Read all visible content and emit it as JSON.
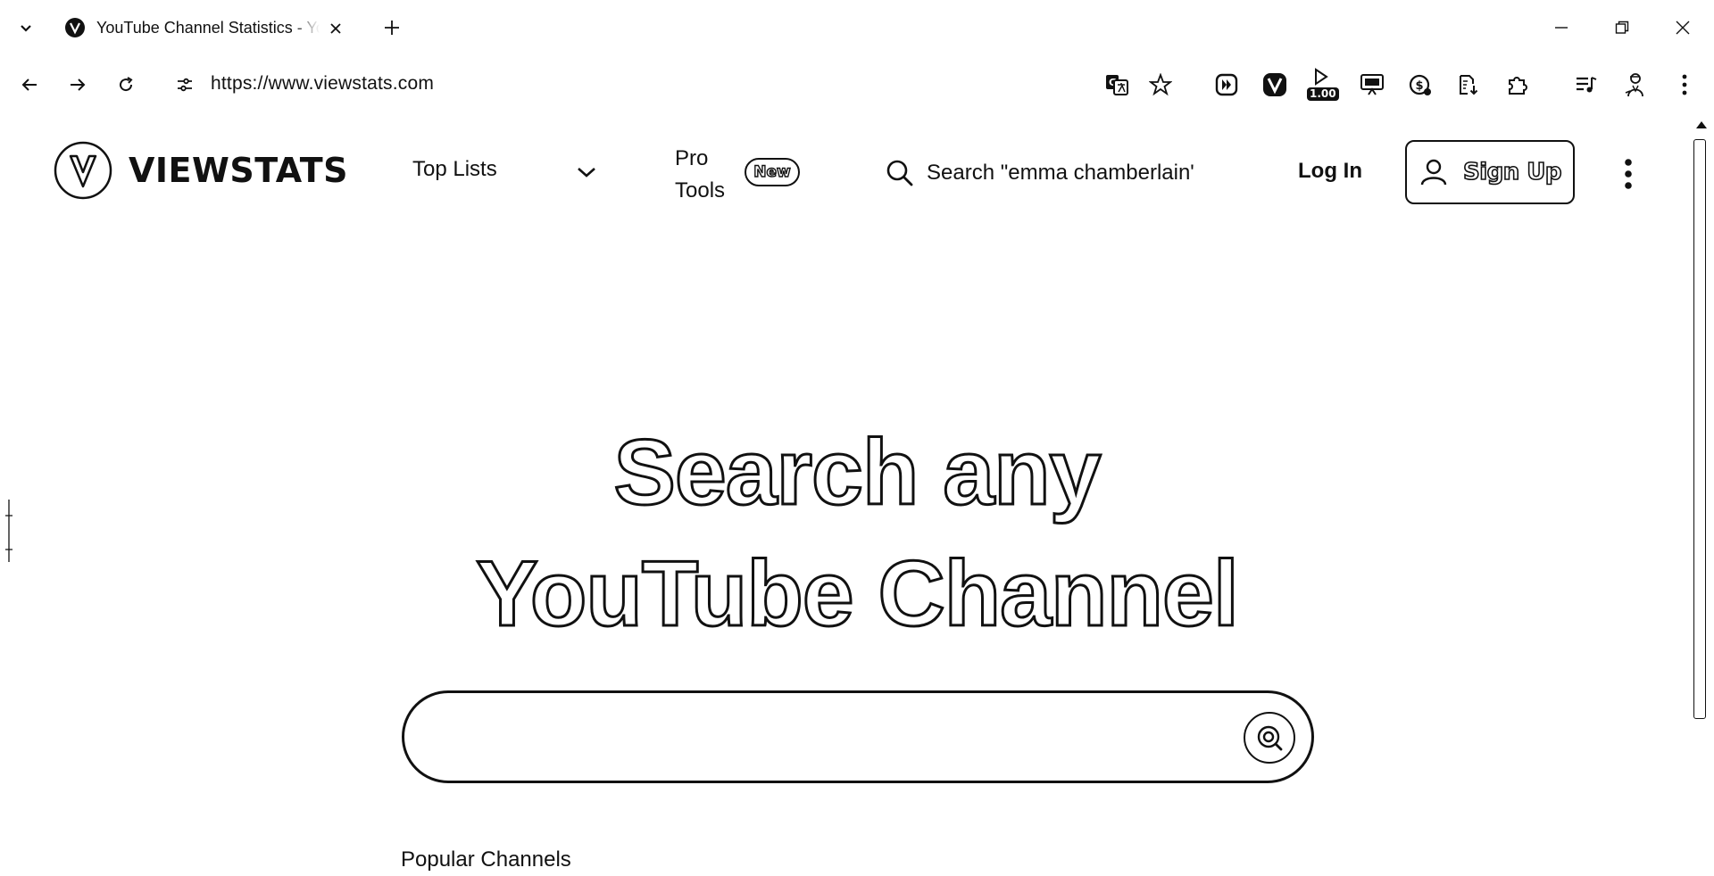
{
  "browser": {
    "tab_title": "YouTube Channel Statistics - YouTube",
    "url": "https://www.viewstats.com",
    "extensions": [
      {
        "name": "translate-icon"
      },
      {
        "name": "bookmark-star-icon"
      },
      {
        "name": "video-speed-icon"
      },
      {
        "name": "viewstats-extension-icon"
      },
      {
        "name": "playback-rate-icon",
        "badge": "1.00"
      },
      {
        "name": "screen-share-icon"
      },
      {
        "name": "coin-extension-icon"
      },
      {
        "name": "document-download-icon"
      },
      {
        "name": "extensions-puzzle-icon"
      },
      {
        "name": "media-queue-icon"
      },
      {
        "name": "profile-avatar-icon"
      },
      {
        "name": "browser-menu-icon"
      }
    ]
  },
  "site": {
    "logo_text": "VIEWSTATS",
    "nav": {
      "top_lists": "Top Lists",
      "pro_tools": "Pro Tools",
      "new_badge": "New"
    },
    "search_placeholder": "Search \"emma chamberlain\"",
    "login": "Log In",
    "signup": "Sign Up"
  },
  "hero": {
    "title_line1": "Search any",
    "title_line2": "YouTube Channel",
    "search_value": "",
    "popular_label": "Popular Channels"
  }
}
